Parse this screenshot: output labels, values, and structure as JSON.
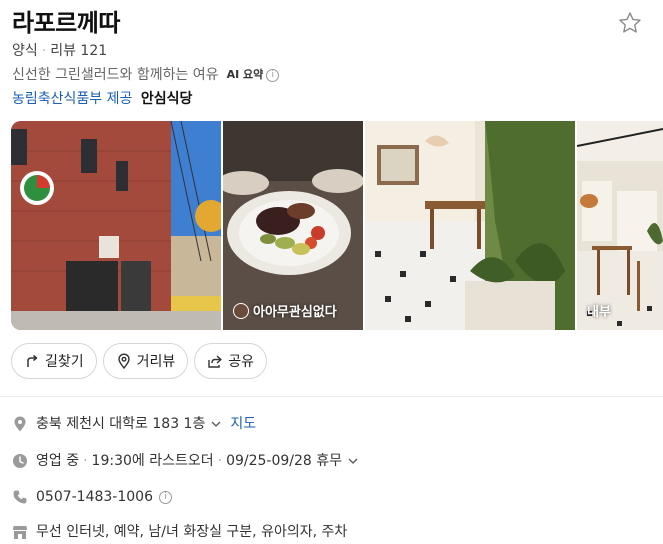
{
  "place": {
    "name": "라포르께따",
    "category": "양식",
    "review_label": "리뷰 121",
    "summary": "신선한 그린샐러드와 함께하는 여유",
    "ai_label": "AI 요약",
    "certified_by": "농림축산식품부 제공",
    "certified_badge": "안심식당"
  },
  "photos": [
    {
      "caption": ""
    },
    {
      "caption": "아아무관심없다"
    },
    {
      "caption": ""
    },
    {
      "caption": "내부"
    }
  ],
  "actions": {
    "directions": "길찾기",
    "street_view": "거리뷰",
    "share": "공유"
  },
  "info": {
    "address": "충북 제천시 대학로 183 1층",
    "map_link": "지도",
    "status": "영업 중",
    "last_order": "19:30에 라스트오더",
    "holiday": "09/25-09/28 휴무",
    "phone": "0507-1483-1006",
    "amenities": "무선 인터넷, 예약, 남/녀 화장실 구분, 유아의자, 주차"
  },
  "colors": {
    "link": "#1a5fb4",
    "icon_gray": "#9a9a9a"
  }
}
